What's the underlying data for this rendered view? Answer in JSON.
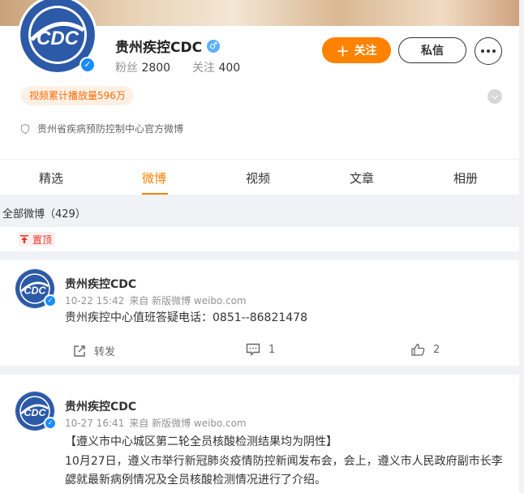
{
  "profile": {
    "name": "贵州疾控CDC",
    "gender_icon": "male-icon",
    "fans_label": "粉丝",
    "fans_count": "2800",
    "follow_label": "关注",
    "follow_count": "400",
    "follow_button": "关注",
    "message_button": "私信",
    "views_badge": "视频累计播放量596万",
    "description": "贵州省疾病预防控制中心官方微博",
    "avatar_text": "CDC"
  },
  "tabs": [
    {
      "label": "精选"
    },
    {
      "label": "微博",
      "active": true
    },
    {
      "label": "视频"
    },
    {
      "label": "文章"
    },
    {
      "label": "相册"
    }
  ],
  "all_weibo_label": "全部微博（429）",
  "pinned_label": "置顶",
  "posts": [
    {
      "author": "贵州疾控CDC",
      "time": "10-22 15:42",
      "source": "来自 新版微博 weibo.com",
      "text": "贵州疾控中心值班答疑电话：0851--86821478",
      "repost_label": "转发",
      "comment_count": "1",
      "like_count": "2"
    },
    {
      "author": "贵州疾控CDC",
      "time": "10-27 16:41",
      "source": "来自 新版微博 weibo.com",
      "text_line1": "【遵义市中心城区第二轮全员核酸检测结果均为阴性】",
      "text_line2": "10月27日，遵义市举行新冠肺炎疫情防控新闻发布会，会上，遵义市人民政府副市长李",
      "text_line3": "勰就最新病例情况及全员核酸检测情况进行了介绍。"
    }
  ],
  "colors": {
    "accent": "#ff8200",
    "verified": "#1a8cff",
    "pinned": "#e3362a"
  }
}
